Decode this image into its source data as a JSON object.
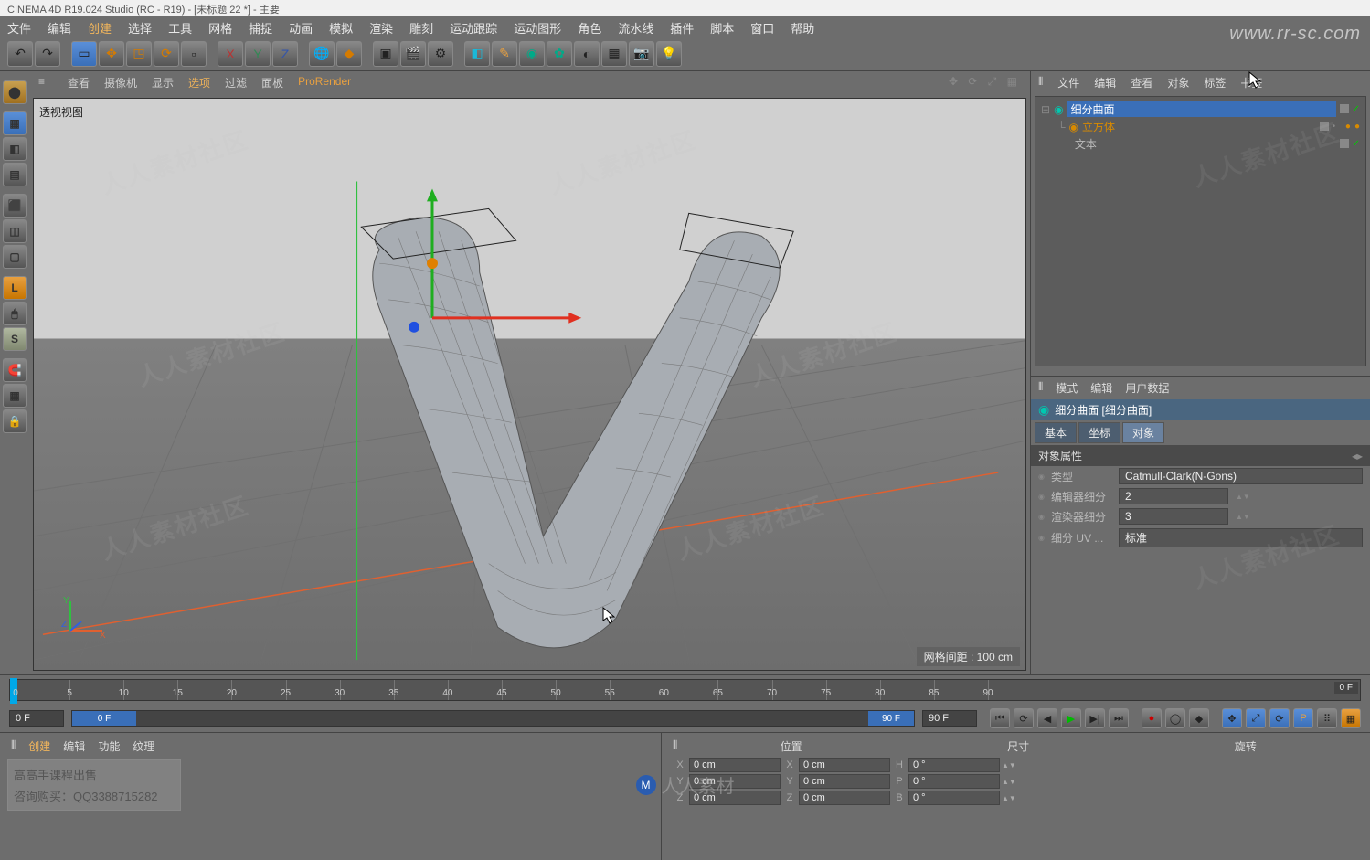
{
  "titlebar": "CINEMA 4D R19.024 Studio (RC - R19) - [未标题 22 *] - 主要",
  "menubar": [
    "文件",
    "编辑",
    "创建",
    "选择",
    "工具",
    "网格",
    "捕捉",
    "动画",
    "模拟",
    "渲染",
    "雕刻",
    "运动跟踪",
    "运动图形",
    "角色",
    "流水线",
    "插件",
    "脚本",
    "窗口",
    "帮助"
  ],
  "view_menubar": [
    "查看",
    "摄像机",
    "显示",
    "选项",
    "过滤",
    "面板",
    "ProRender"
  ],
  "viewport": {
    "label": "透视视图",
    "grid_status": "网格间距 : 100 cm"
  },
  "axis_labels": {
    "x": "X",
    "y": "Y",
    "z": "Z"
  },
  "right_menu": [
    "文件",
    "编辑",
    "查看",
    "对象",
    "标签",
    "书签"
  ],
  "tree": [
    {
      "name": "细分曲面",
      "color": "#00c8b0",
      "selected": true
    },
    {
      "name": "立方体",
      "color": "#d88a00",
      "indent": 1
    },
    {
      "name": "文本",
      "color": "#00c8b0",
      "indent": 1
    }
  ],
  "attr_menu": [
    "模式",
    "编辑",
    "用户数据"
  ],
  "attr_title": "细分曲面 [细分曲面]",
  "attr_tabs": [
    "基本",
    "坐标",
    "对象"
  ],
  "attr_section": "对象属性",
  "attr_rows": {
    "type_label": "类型",
    "type_value": "Catmull-Clark(N-Gons)",
    "editor_sub_label": "编辑器细分",
    "editor_sub_value": "2",
    "render_sub_label": "渲染器细分",
    "render_sub_value": "3",
    "uv_label": "细分 UV ...",
    "uv_value": "标准"
  },
  "timeline": {
    "ticks": [
      0,
      5,
      10,
      15,
      20,
      25,
      30,
      35,
      40,
      45,
      50,
      55,
      60,
      65,
      70,
      75,
      80,
      85,
      90
    ],
    "start": "0 F",
    "range_left": "0 F",
    "range_right": "90 F",
    "end": "90 F"
  },
  "bl_tabs": [
    "创建",
    "编辑",
    "功能",
    "纹理"
  ],
  "ad": {
    "line1": "高高手课程出售",
    "line2": "咨询购买：QQ3388715282"
  },
  "coord": {
    "headers": [
      "位置",
      "尺寸",
      "旋转"
    ],
    "rows": [
      {
        "axis": "X",
        "pos": "0 cm",
        "sizeAxis": "X",
        "size": "0 cm",
        "rotAxis": "H",
        "rot": "0 °"
      },
      {
        "axis": "Y",
        "pos": "0 cm",
        "sizeAxis": "Y",
        "size": "0 cm",
        "rotAxis": "P",
        "rot": "0 °"
      },
      {
        "axis": "Z",
        "pos": "0 cm",
        "sizeAxis": "Z",
        "size": "0 cm",
        "rotAxis": "B",
        "rot": "0 °"
      }
    ]
  },
  "watermark_text": "人人素材社区",
  "watermark_url": "www.rr-sc.com",
  "watermark_bottom": "人人素材"
}
